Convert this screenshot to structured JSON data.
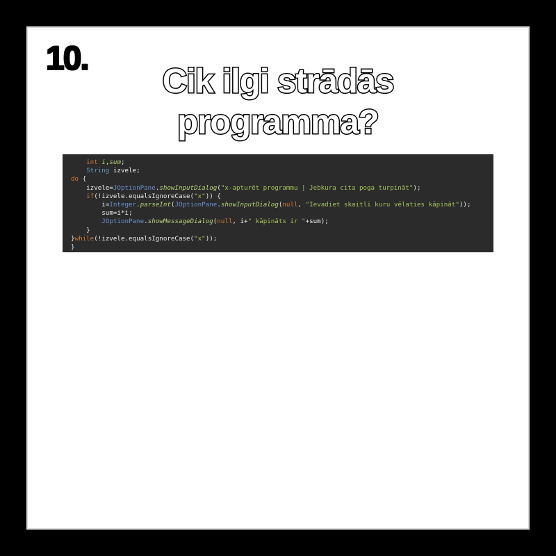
{
  "slide": {
    "number": "10.",
    "title_line1": "Cik ilgi strādās",
    "title_line2": "programma?"
  },
  "code": {
    "lines": [
      "",
      "    int i,sum;",
      "    String izvele;",
      "do {",
      "    izvele=JOptionPane.showInputDialog(\"x-apturēt programmu | Jebkura cita poga turpināt\");",
      "    if(!izvele.equalsIgnoreCase(\"x\")) {",
      "        i=Integer.parseInt(JOptionPane.showInputDialog(null, \"Ievadiet skaitli kuru vēlaties kāpināt\"));",
      "        sum=i*i;",
      "        JOptionPane.showMessageDialog(null, i+\" kāpināts ir \"+sum);",
      "    }",
      "}while(!izvele.equalsIgnoreCase(\"x\"));",
      "}"
    ]
  },
  "colors": {
    "background": "#000000",
    "slide": "#ffffff",
    "code_bg": "#2b2b2b"
  }
}
